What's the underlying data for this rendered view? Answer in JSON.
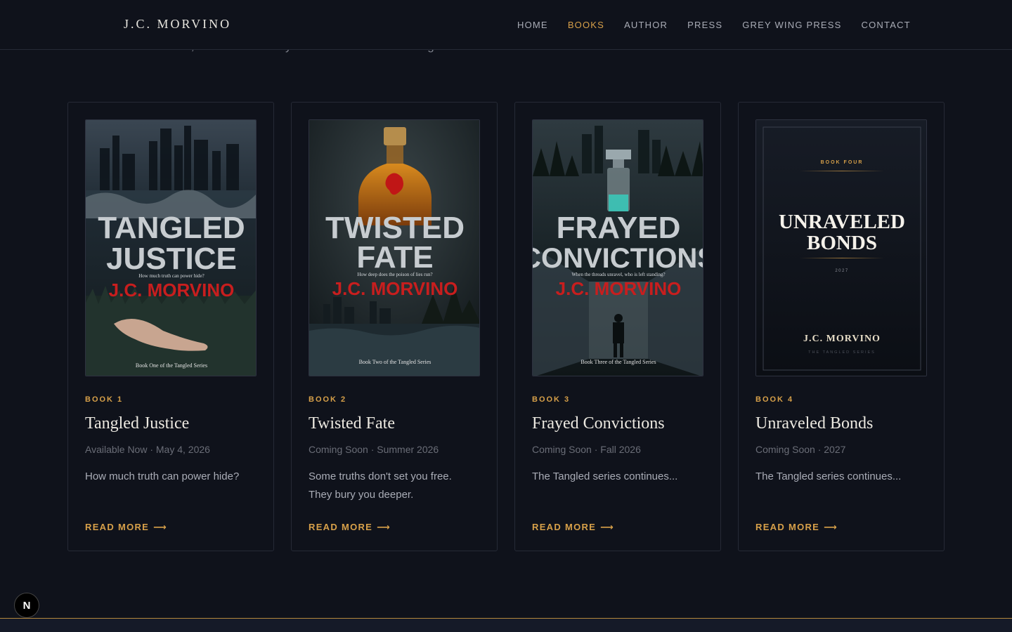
{
  "header": {
    "brand": "J.C. MORVINO",
    "nav": [
      {
        "label": "HOME",
        "active": false
      },
      {
        "label": "BOOKS",
        "active": true
      },
      {
        "label": "AUTHOR",
        "active": false
      },
      {
        "label": "PRESS",
        "active": false
      },
      {
        "label": "GREY WING PRESS",
        "active": false
      },
      {
        "label": "CONTACT",
        "active": false
      }
    ]
  },
  "intro_partial": "and start with book one, then follow Kasey Landon back into San Angelo.",
  "colors": {
    "accent": "#d7a049",
    "background": "#0f121b",
    "card_border": "#262a36",
    "cover_red": "#c81e1e"
  },
  "books": [
    {
      "number_label": "BOOK 1",
      "title": "Tangled Justice",
      "status": "Available Now · May 4, 2026",
      "description": "How much truth can power hide?",
      "read_more": "READ MORE",
      "cover": {
        "title_line1": "TANGLED",
        "title_line2": "JUSTICE",
        "tagline": "How much truth can power hide?",
        "author": "J.C. MORVINO",
        "series_line": "Book One of the Tangled Series"
      }
    },
    {
      "number_label": "BOOK 2",
      "title": "Twisted Fate",
      "status": "Coming Soon · Summer 2026",
      "description": "Some truths don't set you free. They bury you deeper.",
      "read_more": "READ MORE",
      "cover": {
        "title_line1": "TWISTED",
        "title_line2": "FATE",
        "tagline": "How deep does the poison of lies run?",
        "author": "J.C. MORVINO",
        "series_line": "Book Two of the Tangled Series"
      }
    },
    {
      "number_label": "BOOK 3",
      "title": "Frayed Convictions",
      "status": "Coming Soon · Fall 2026",
      "description": "The Tangled series continues...",
      "read_more": "READ MORE",
      "cover": {
        "title_line1": "FRAYED",
        "title_line2": "CONVICTIONS",
        "tagline": "When the threads unravel, who is left standing?",
        "author": "J.C. MORVINO",
        "series_line": "Book Three of the Tangled Series"
      }
    },
    {
      "number_label": "BOOK 4",
      "title": "Unraveled Bonds",
      "status": "Coming Soon · 2027",
      "description": "The Tangled series continues...",
      "read_more": "READ MORE",
      "cover": {
        "kicker": "BOOK FOUR",
        "title_line1": "UNRAVELED",
        "title_line2": "BONDS",
        "year": "2027",
        "author": "J.C. MORVINO",
        "series_line": "THE TANGLED SERIES"
      }
    }
  ],
  "floating_badge": "N"
}
